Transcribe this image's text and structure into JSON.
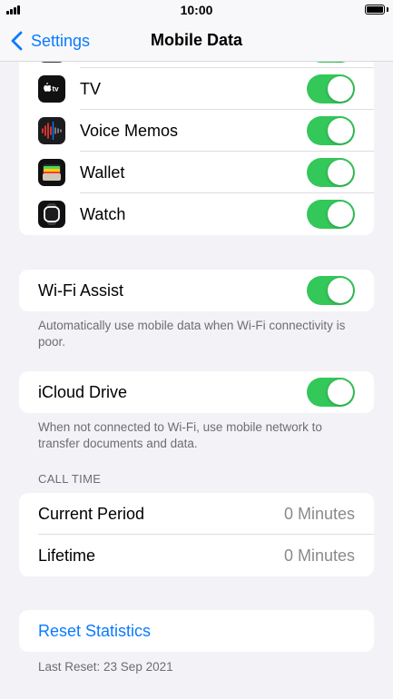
{
  "status_bar": {
    "time": "10:00"
  },
  "nav": {
    "back_label": "Settings",
    "title": "Mobile Data"
  },
  "apps": [
    {
      "label": "TV",
      "icon": "apple-tv-icon",
      "enabled": true
    },
    {
      "label": "Voice Memos",
      "icon": "voice-memos-icon",
      "enabled": true
    },
    {
      "label": "Wallet",
      "icon": "wallet-icon",
      "enabled": true
    },
    {
      "label": "Watch",
      "icon": "watch-icon",
      "enabled": true
    }
  ],
  "wifi_assist": {
    "label": "Wi-Fi Assist",
    "enabled": true,
    "footnote": "Automatically use mobile data when Wi-Fi connectivity is poor."
  },
  "icloud_drive": {
    "label": "iCloud Drive",
    "enabled": true,
    "footnote": "When not connected to Wi-Fi, use mobile network to transfer documents and data."
  },
  "call_time": {
    "header": "CALL TIME",
    "rows": [
      {
        "label": "Current Period",
        "value": "0 Minutes"
      },
      {
        "label": "Lifetime",
        "value": "0 Minutes"
      }
    ]
  },
  "reset": {
    "label": "Reset Statistics",
    "last_reset": "Last Reset: 23 Sep 2021"
  },
  "colors": {
    "accent": "#0a7aff",
    "toggle_on": "#34c759",
    "background": "#f2f2f7"
  }
}
